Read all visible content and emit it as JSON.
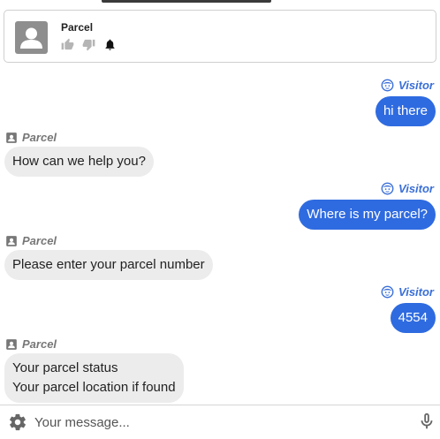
{
  "header": {
    "title": "Parcel",
    "icons": [
      "avatar-icon",
      "thumbs-up-icon",
      "thumbs-down-icon",
      "bell-icon"
    ]
  },
  "colors": {
    "visitor_bubble": "#2f6be0",
    "visitor_name": "#3a6fd8",
    "bot_bubble": "#ececec",
    "bot_name": "#777777"
  },
  "messages": [
    {
      "sender": "visitor",
      "name": "Visitor",
      "lines": [
        "hi there"
      ]
    },
    {
      "sender": "bot",
      "name": "Parcel",
      "lines": [
        "How can we help you?"
      ]
    },
    {
      "sender": "visitor",
      "name": "Visitor",
      "lines": [
        "Where is my parcel?"
      ]
    },
    {
      "sender": "bot",
      "name": "Parcel",
      "lines": [
        "Please enter your parcel number"
      ]
    },
    {
      "sender": "visitor",
      "name": "Visitor",
      "lines": [
        "4554"
      ]
    },
    {
      "sender": "bot",
      "name": "Parcel",
      "lines": [
        "Your parcel status",
        "Your parcel location if found"
      ]
    }
  ],
  "composer": {
    "placeholder": "Your message...",
    "value": "",
    "icons": [
      "settings-icon",
      "microphone-icon"
    ]
  }
}
